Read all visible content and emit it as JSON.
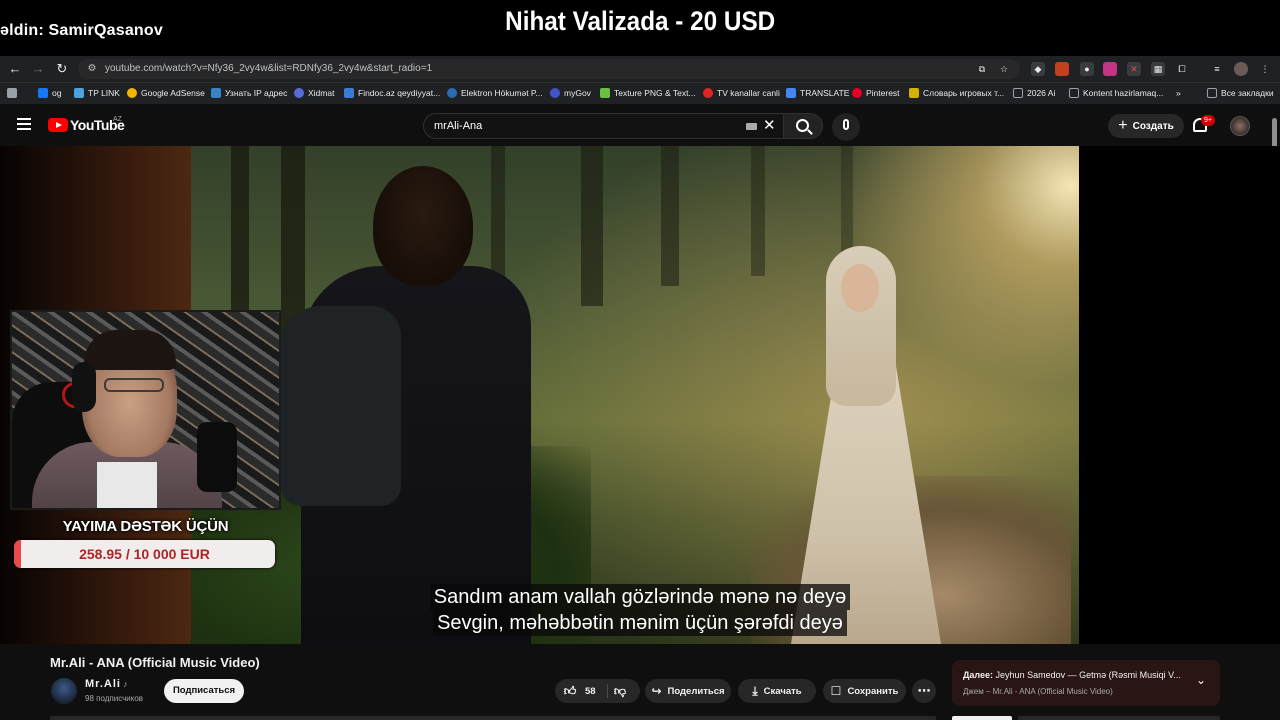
{
  "overlay": {
    "donor_text": "əldin: SamirQasanov",
    "stream_title": "Nihat Valizada - 20 USD"
  },
  "browser": {
    "url": "youtube.com/watch?v=Nfy36_2vy4w&list=RDNfy36_2vy4w&start_radio=1",
    "bookmarks": [
      {
        "label": "og",
        "color": "#1877f2"
      },
      {
        "label": "TP LINK",
        "color": "#4aa3df"
      },
      {
        "label": "Google AdSense",
        "color": "#f4b400"
      },
      {
        "label": "Узнать IP адрес",
        "color": "#3b82c4"
      },
      {
        "label": "Xidmat",
        "color": "#5b6bd6"
      },
      {
        "label": "Findoc.az qeydiyyat...",
        "color": "#3a7bd5"
      },
      {
        "label": "Elektron Hökumət P...",
        "color": "#2b6cb0"
      },
      {
        "label": "myGov",
        "color": "#4453c9"
      },
      {
        "label": "Texture PNG & Text...",
        "color": "#6abf40"
      },
      {
        "label": "TV kanallar canli",
        "color": "#e02424"
      },
      {
        "label": "TRANSLATE",
        "color": "#4285f4"
      },
      {
        "label": "Pinterest",
        "color": "#e60023"
      },
      {
        "label": "Словарь игровых т...",
        "color": "#d4b106"
      },
      {
        "label": "2026 Ai",
        "color": "#9aa0a6"
      },
      {
        "label": "Kontent hazirlamaq...",
        "color": "#9aa0a6"
      },
      {
        "label": "Все закладки",
        "color": "#9aa0a6"
      }
    ]
  },
  "youtube": {
    "logo_text": "YouTube",
    "region": "AZ",
    "search_value": "mrAli-Ana",
    "create_label": "Создать",
    "notifications_badge": "9+"
  },
  "player": {
    "subtitle_line1": "Sandım anam vallah gözlərində mənə nə deyə",
    "subtitle_line2": "Sevgin, məhəbbətin mənim üçün şərəfdi deyə"
  },
  "donation": {
    "label": "YAYIMA DƏSTƏK ÜÇÜN",
    "progress_text": "258.95 / 10 000 EUR",
    "progress_fraction": 0.0259
  },
  "video": {
    "title": "Mr.Ali - ANA (Official Music Video)",
    "channel_name": "Mr.Ali",
    "subscriber_count": "98 подписчиков",
    "subscribe_label": "Подписаться",
    "like_count": "58",
    "share_label": "Поделиться",
    "download_label": "Скачать",
    "save_label": "Сохранить"
  },
  "up_next": {
    "label": "Далее:",
    "title": "Jeyhun Samedov — Getmə (Rəsmi Musiqi V...",
    "subtitle": "Джем – Mr.Ali - ANA (Official Music Video)"
  },
  "colors": {
    "youtube_red": "#ff0000",
    "donation_fill": "#e84a4a",
    "background": "#0f0f0f"
  }
}
